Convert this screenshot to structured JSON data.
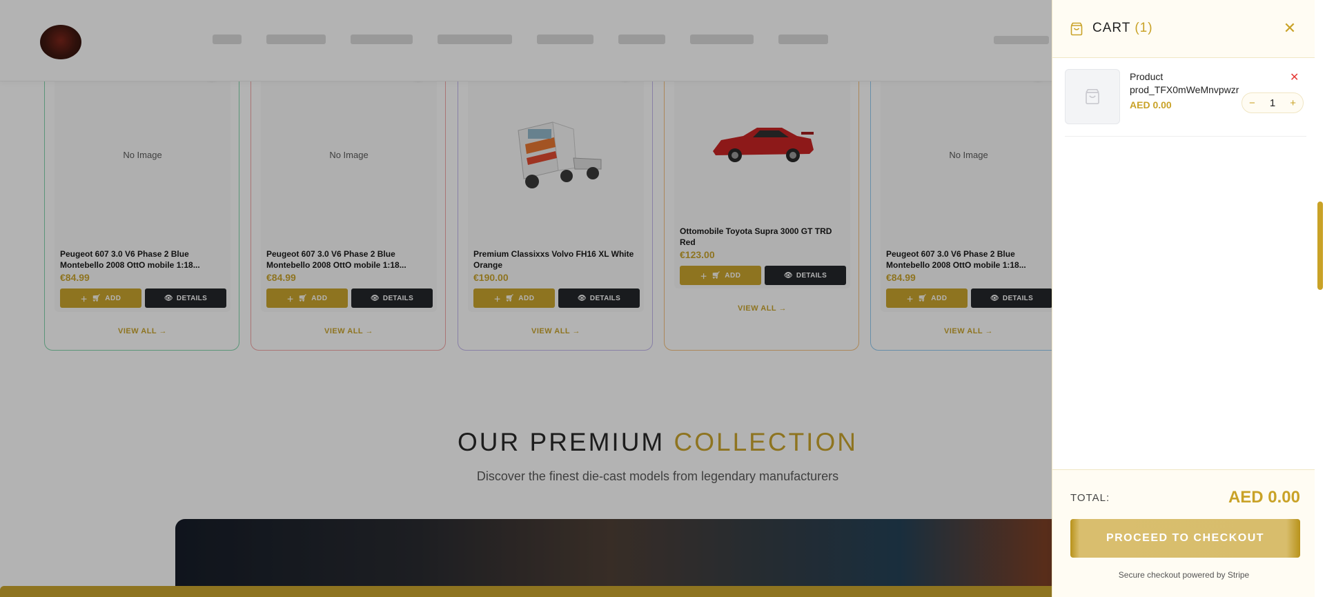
{
  "products": [
    {
      "image_text": "No Image",
      "name": "Peugeot 607 3.0 V6 Phase 2 Blue Montebello 2008 OttO mobile 1:18...",
      "price": "€84.99",
      "add_label": "ADD",
      "details_label": "DETAILS",
      "view_all": "VIEW ALL →",
      "border_color": "#7dd3a8",
      "image_kind": "none"
    },
    {
      "image_text": "No Image",
      "name": "Peugeot 607 3.0 V6 Phase 2 Blue Montebello 2008 OttO mobile 1:18...",
      "price": "€84.99",
      "add_label": "ADD",
      "details_label": "DETAILS",
      "view_all": "VIEW ALL →",
      "border_color": "#f2a3a3",
      "image_kind": "none"
    },
    {
      "image_text": "",
      "name": "Premium Classixxs Volvo FH16 XL White Orange",
      "price": "€190.00",
      "add_label": "ADD",
      "details_label": "DETAILS",
      "view_all": "VIEW ALL →",
      "border_color": "#c0b4ec",
      "image_kind": "truck"
    },
    {
      "image_text": "",
      "name": "Ottomobile Toyota Supra 3000 GT TRD Red",
      "price": "€123.00",
      "add_label": "ADD",
      "details_label": "DETAILS",
      "view_all": "VIEW ALL →",
      "border_color": "#f5bf7a",
      "image_kind": "car"
    },
    {
      "image_text": "No Image",
      "name": "Peugeot 607 3.0 V6 Phase 2 Blue Montebello 2008 OttO mobile 1:18...",
      "price": "€84.99",
      "add_label": "ADD",
      "details_label": "DETAILS",
      "view_all": "VIEW ALL →",
      "border_color": "#8ec9f0",
      "image_kind": "none"
    }
  ],
  "section": {
    "title_main": "OUR PREMIUM ",
    "title_accent": "COLLECTION",
    "subtitle": "Discover the finest die-cast models from legendary manufacturers"
  },
  "cart": {
    "title": "CART",
    "count": "(1)",
    "items": [
      {
        "name": "Product prod_TFX0mWeMnvpwzr",
        "price": "AED 0.00",
        "quantity": "1"
      }
    ],
    "total_label": "TOTAL:",
    "total_value": "AED 0.00",
    "checkout_label": "PROCEED TO CHECKOUT",
    "secure_note": "Secure checkout powered by Stripe"
  },
  "colors": {
    "accent": "#c9a227",
    "dark_button": "#1c1f24",
    "remove": "#e53935"
  },
  "icons": {
    "cart_header": "shopping-bag-icon",
    "close": "close-icon",
    "remove_item": "x-icon",
    "add": "plus-icon",
    "cart_small": "cart-icon",
    "details": "eye-icon",
    "favorite": "heart-icon"
  }
}
